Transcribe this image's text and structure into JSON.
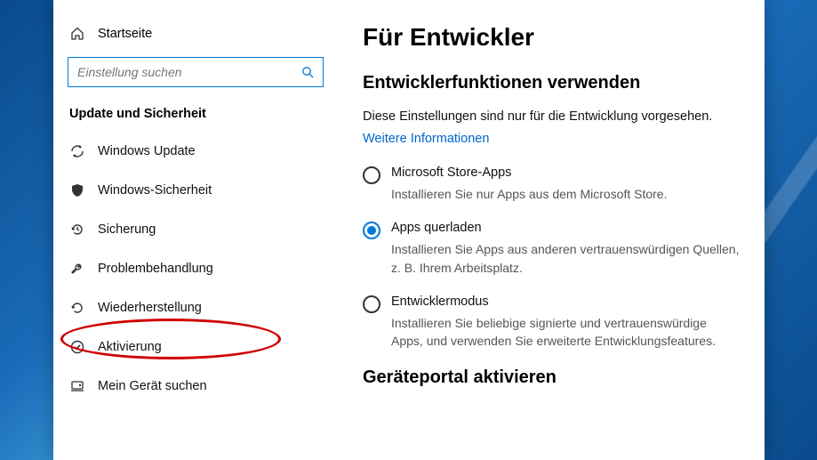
{
  "sidebar": {
    "home_label": "Startseite",
    "search_placeholder": "Einstellung suchen",
    "section_title": "Update und Sicherheit",
    "items": [
      {
        "label": "Windows Update"
      },
      {
        "label": "Windows-Sicherheit"
      },
      {
        "label": "Sicherung"
      },
      {
        "label": "Problembehandlung"
      },
      {
        "label": "Wiederherstellung"
      },
      {
        "label": "Aktivierung"
      },
      {
        "label": "Mein Gerät suchen"
      }
    ]
  },
  "content": {
    "page_title": "Für Entwickler",
    "section1_heading": "Entwicklerfunktionen verwenden",
    "section1_desc": "Diese Einstellungen sind nur für die Entwicklung vorgesehen.",
    "more_info_link": "Weitere Informationen",
    "radios": [
      {
        "label": "Microsoft Store-Apps",
        "desc": "Installieren Sie nur Apps aus dem Microsoft Store.",
        "selected": false
      },
      {
        "label": "Apps querladen",
        "desc": "Installieren Sie Apps aus anderen vertrauenswürdigen Quellen, z. B. Ihrem Arbeitsplatz.",
        "selected": true
      },
      {
        "label": "Entwicklermodus",
        "desc": "Installieren Sie beliebige signierte und vertrauenswürdige Apps, und verwenden Sie erweiterte Entwicklungsfeatures.",
        "selected": false
      }
    ],
    "section2_heading": "Geräteportal aktivieren"
  }
}
